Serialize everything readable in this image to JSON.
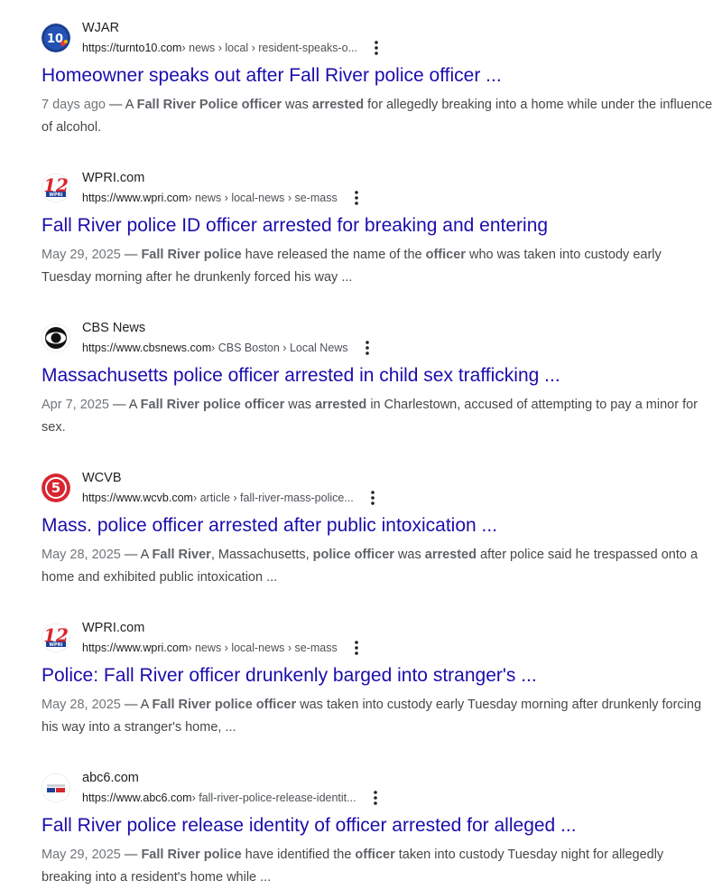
{
  "colors": {
    "link": "#1a0dab",
    "site": "#202124",
    "url": "#4d5156",
    "snippet": "#474747",
    "date": "#70757a"
  },
  "results": [
    {
      "site": "WJAR",
      "favicon": "wjar-10-icon",
      "url_base": "https://turnto10.com",
      "url_path": " › news › local › resident-speaks-o...",
      "title": "Homeowner speaks out after Fall River police officer ...",
      "date": "7 days ago",
      "snippet_parts": [
        {
          "t": " — A ",
          "b": false
        },
        {
          "t": "Fall River Police officer",
          "b": true
        },
        {
          "t": " was ",
          "b": false
        },
        {
          "t": "arrested",
          "b": true
        },
        {
          "t": " for allegedly breaking into a home while under the influence of alcohol.",
          "b": false
        }
      ]
    },
    {
      "site": "WPRI.com",
      "favicon": "wpri-12-icon",
      "url_base": "https://www.wpri.com",
      "url_path": " › news › local-news › se-mass",
      "title": "Fall River police ID officer arrested for breaking and entering",
      "date": "May 29, 2025",
      "snippet_parts": [
        {
          "t": " — ",
          "b": false
        },
        {
          "t": "Fall River police",
          "b": true
        },
        {
          "t": " have released the name of the ",
          "b": false
        },
        {
          "t": "officer",
          "b": true
        },
        {
          "t": " who was taken into custody early Tuesday morning after he drunkenly forced his way ...",
          "b": false
        }
      ]
    },
    {
      "site": "CBS News",
      "favicon": "cbs-eye-icon",
      "url_base": "https://www.cbsnews.com",
      "url_path": " › CBS Boston › Local News",
      "title": "Massachusetts police officer arrested in child sex trafficking ...",
      "date": "Apr 7, 2025",
      "snippet_parts": [
        {
          "t": " — A ",
          "b": false
        },
        {
          "t": "Fall River police officer",
          "b": true
        },
        {
          "t": " was ",
          "b": false
        },
        {
          "t": "arrested",
          "b": true
        },
        {
          "t": " in Charlestown, accused of attempting to pay a minor for sex.",
          "b": false
        }
      ]
    },
    {
      "site": "WCVB",
      "favicon": "wcvb-5-icon",
      "url_base": "https://www.wcvb.com",
      "url_path": " › article › fall-river-mass-police...",
      "title": "Mass. police officer arrested after public intoxication ...",
      "date": "May 28, 2025",
      "snippet_parts": [
        {
          "t": " — A ",
          "b": false
        },
        {
          "t": "Fall River",
          "b": true
        },
        {
          "t": ", Massachusetts, ",
          "b": false
        },
        {
          "t": "police officer",
          "b": true
        },
        {
          "t": " was ",
          "b": false
        },
        {
          "t": "arrested",
          "b": true
        },
        {
          "t": " after police said he trespassed onto a home and exhibited public intoxication ...",
          "b": false
        }
      ]
    },
    {
      "site": "WPRI.com",
      "favicon": "wpri-12-icon",
      "url_base": "https://www.wpri.com",
      "url_path": " › news › local-news › se-mass",
      "title": "Police: Fall River officer drunkenly barged into stranger's ...",
      "date": "May 28, 2025",
      "snippet_parts": [
        {
          "t": " — A ",
          "b": false
        },
        {
          "t": "Fall River police officer",
          "b": true
        },
        {
          "t": " was taken into custody early Tuesday morning after drunkenly forcing his way into a stranger's home, ...",
          "b": false
        }
      ]
    },
    {
      "site": "abc6.com",
      "favicon": "abc6-icon",
      "url_base": "https://www.abc6.com",
      "url_path": " › fall-river-police-release-identit...",
      "title": "Fall River police release identity of officer arrested for alleged ...",
      "date": "May 29, 2025",
      "snippet_parts": [
        {
          "t": " — ",
          "b": false
        },
        {
          "t": "Fall River police",
          "b": true
        },
        {
          "t": " have identified the ",
          "b": false
        },
        {
          "t": "officer",
          "b": true
        },
        {
          "t": " taken into custody Tuesday night for allegedly breaking into a resident's home while ...",
          "b": false
        }
      ]
    }
  ]
}
